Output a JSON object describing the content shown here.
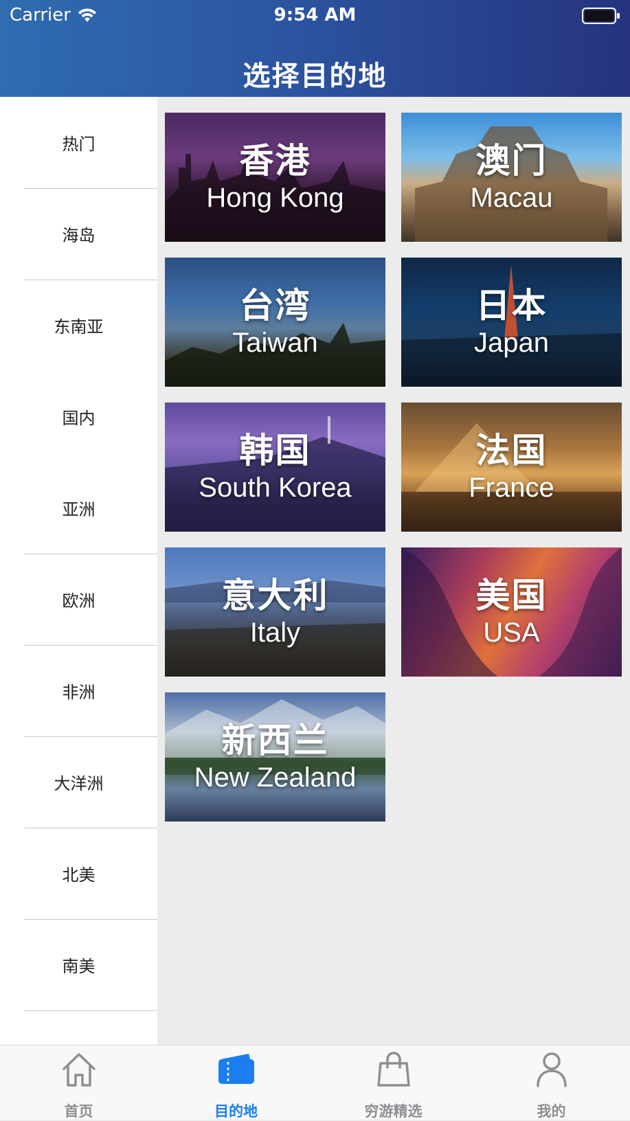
{
  "status_bar": {
    "carrier": "Carrier",
    "time": "9:54 AM",
    "wifi_icon": "wifi-icon",
    "battery_icon": "battery-icon"
  },
  "nav": {
    "title": "选择目的地"
  },
  "sidebar": {
    "items": [
      {
        "label": "热门"
      },
      {
        "label": "海岛"
      },
      {
        "label": "东南亚"
      },
      {
        "label": "国内"
      },
      {
        "label": "亚洲"
      },
      {
        "label": "欧洲"
      },
      {
        "label": "非洲"
      },
      {
        "label": "大洋洲"
      },
      {
        "label": "北美"
      },
      {
        "label": "南美"
      }
    ]
  },
  "destinations": [
    {
      "cn": "香港",
      "en": "Hong Kong"
    },
    {
      "cn": "澳门",
      "en": "Macau"
    },
    {
      "cn": "台湾",
      "en": "Taiwan"
    },
    {
      "cn": "日本",
      "en": "Japan"
    },
    {
      "cn": "韩国",
      "en": "South Korea"
    },
    {
      "cn": "法国",
      "en": "France"
    },
    {
      "cn": "意大利",
      "en": "Italy"
    },
    {
      "cn": "美国",
      "en": "USA"
    },
    {
      "cn": "新西兰",
      "en": "New Zealand"
    }
  ],
  "tabbar": {
    "accent_color": "#1a7ef0",
    "inactive_color": "#8e8e93",
    "tabs": [
      {
        "label": "首页",
        "icon": "home-icon"
      },
      {
        "label": "目的地",
        "icon": "ticket-icon",
        "active": true
      },
      {
        "label": "穷游精选",
        "icon": "shopping-bag-icon"
      },
      {
        "label": "我的",
        "icon": "person-icon"
      }
    ]
  }
}
